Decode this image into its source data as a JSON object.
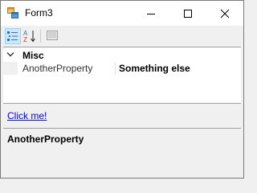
{
  "window": {
    "title": "Form3"
  },
  "toolbar": {
    "categorized_icon": "categorized-icon",
    "alphabetical_icon": "alphabetical-icon",
    "property_pages_icon": "property-pages-icon"
  },
  "grid": {
    "category": {
      "label": "Misc",
      "expanded": true
    },
    "properties": [
      {
        "name": "AnotherProperty",
        "value": "Something else"
      }
    ]
  },
  "commands": {
    "link_label": "Click me!"
  },
  "description": {
    "title": "AnotherProperty",
    "text": ""
  },
  "colors": {
    "toolbar_selected_bg": "#cce8ff",
    "link": "#0000ee",
    "panel_bg": "#f0f0f0"
  }
}
